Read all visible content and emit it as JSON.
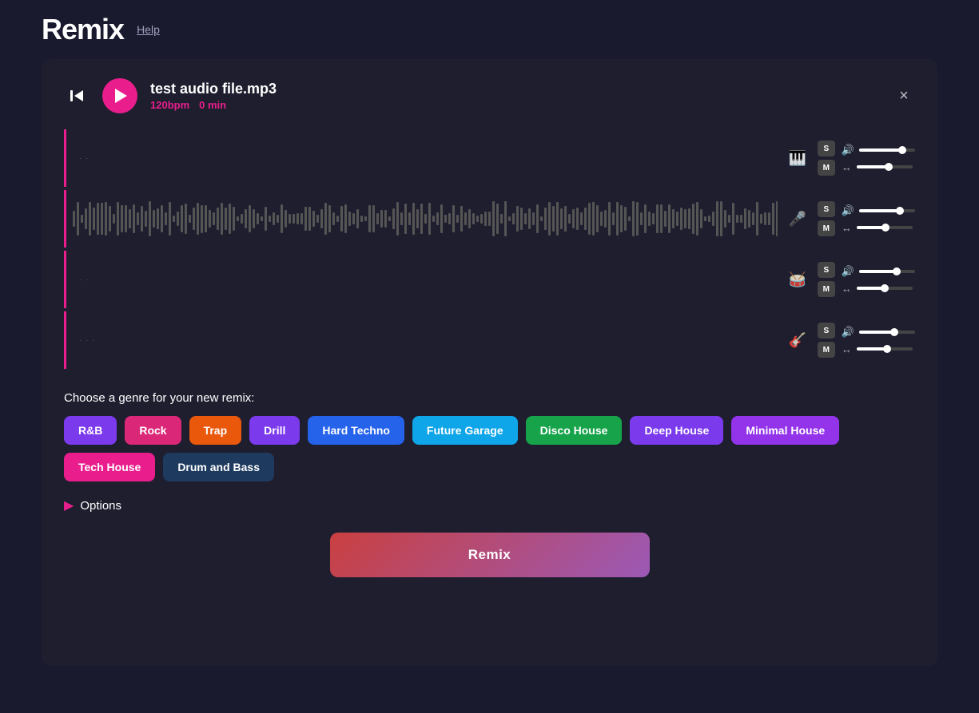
{
  "app": {
    "title": "Remix",
    "help_link": "Help"
  },
  "player": {
    "file_name": "test audio file.mp3",
    "bpm": "120bpm",
    "duration": "0 min",
    "close_label": "×"
  },
  "tracks": [
    {
      "id": "track-1",
      "icon": "🎹",
      "icon_name": "piano-icon",
      "waveform_type": "sparse",
      "s_label": "S",
      "m_label": "M",
      "volume_pct": 75,
      "pan_pct": 55
    },
    {
      "id": "track-2",
      "icon": "🎤",
      "icon_name": "mic-icon",
      "waveform_type": "dense",
      "s_label": "S",
      "m_label": "M",
      "volume_pct": 70,
      "pan_pct": 50
    },
    {
      "id": "track-3",
      "icon": "🥁",
      "icon_name": "drum-icon",
      "waveform_type": "sparse",
      "s_label": "S",
      "m_label": "M",
      "volume_pct": 65,
      "pan_pct": 48
    },
    {
      "id": "track-4",
      "icon": "🎸",
      "icon_name": "guitar-icon",
      "waveform_type": "sparse",
      "s_label": "S",
      "m_label": "M",
      "volume_pct": 60,
      "pan_pct": 52
    }
  ],
  "genre_section": {
    "label": "Choose a genre for your new remix:",
    "genres": [
      {
        "id": "rnb",
        "label": "R&B",
        "color": "#7c3aed",
        "selected": false
      },
      {
        "id": "rock",
        "label": "Rock",
        "color": "#db2777",
        "selected": false
      },
      {
        "id": "trap",
        "label": "Trap",
        "color": "#ea580c",
        "selected": false
      },
      {
        "id": "drill",
        "label": "Drill",
        "color": "#7c3aed",
        "selected": false
      },
      {
        "id": "hard-techno",
        "label": "Hard Techno",
        "color": "#2563eb",
        "selected": false
      },
      {
        "id": "future-garage",
        "label": "Future Garage",
        "color": "#0ea5e9",
        "selected": false
      },
      {
        "id": "disco-house",
        "label": "Disco House",
        "color": "#16a34a",
        "selected": false
      },
      {
        "id": "deep-house",
        "label": "Deep House",
        "color": "#7c3aed",
        "selected": false
      },
      {
        "id": "minimal-house",
        "label": "Minimal House",
        "color": "#9333ea",
        "selected": false
      },
      {
        "id": "tech-house",
        "label": "Tech House",
        "color": "#e91e8c",
        "selected": false
      },
      {
        "id": "drum-and-bass",
        "label": "Drum and Bass",
        "color": "#1e3a5f",
        "selected": false
      }
    ]
  },
  "options": {
    "label": "Options"
  },
  "remix_button": {
    "label": "Remix"
  }
}
